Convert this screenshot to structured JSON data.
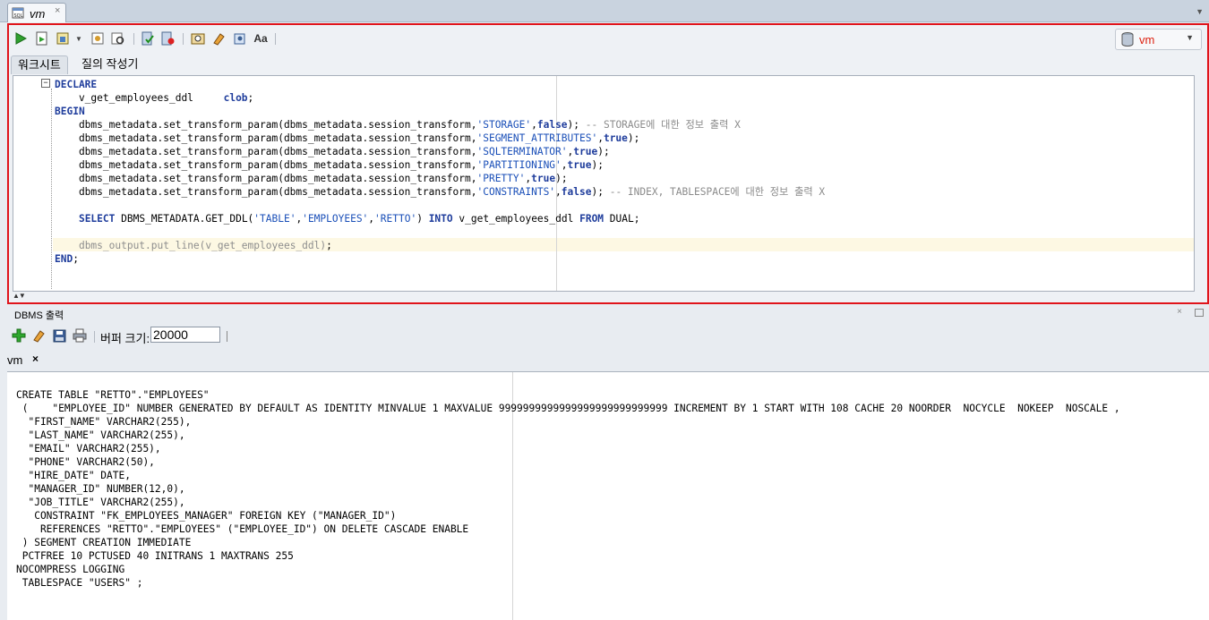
{
  "window_tab": {
    "label": "vm",
    "close": "×"
  },
  "toolbar": {
    "buttons": [
      "run-statement",
      "run-script",
      "autotrace",
      "dropdown",
      "explain-plan",
      "sql-tuning",
      "commit",
      "rollback",
      "sql-history",
      "clear",
      "format",
      "to-upper-lower"
    ],
    "connection": "vm"
  },
  "worksheet_tabs": [
    "워크시트",
    "질의 작성기"
  ],
  "editor": {
    "lines": [
      [
        [
          "kw",
          "DECLARE"
        ]
      ],
      [
        [
          "t",
          "    v_get_employees_ddl     "
        ],
        [
          "kw",
          "clob"
        ],
        [
          "t",
          ";"
        ]
      ],
      [
        [
          "kw",
          "BEGIN"
        ]
      ],
      [
        [
          "t",
          "    dbms_metadata.set_transform_param(dbms_metadata.session_transform,"
        ],
        [
          "str",
          "'STORAGE'"
        ],
        [
          "t",
          ","
        ],
        [
          "kw",
          "false"
        ],
        [
          "t",
          "); "
        ],
        [
          "cmt",
          "-- STORAGE에 대한 정보 출력 X"
        ]
      ],
      [
        [
          "t",
          "    dbms_metadata.set_transform_param(dbms_metadata.session_transform,"
        ],
        [
          "str",
          "'SEGMENT_ATTRIBUTES'"
        ],
        [
          "t",
          ","
        ],
        [
          "kw",
          "true"
        ],
        [
          "t",
          ");"
        ]
      ],
      [
        [
          "t",
          "    dbms_metadata.set_transform_param(dbms_metadata.session_transform,"
        ],
        [
          "str",
          "'SQLTERMINATOR'"
        ],
        [
          "t",
          ","
        ],
        [
          "kw",
          "true"
        ],
        [
          "t",
          ");"
        ]
      ],
      [
        [
          "t",
          "    dbms_metadata.set_transform_param(dbms_metadata.session_transform,"
        ],
        [
          "str",
          "'PARTITIONING'"
        ],
        [
          "t",
          ","
        ],
        [
          "kw",
          "true"
        ],
        [
          "t",
          ");"
        ]
      ],
      [
        [
          "t",
          "    dbms_metadata.set_transform_param(dbms_metadata.session_transform,"
        ],
        [
          "str",
          "'PRETTY'"
        ],
        [
          "t",
          ","
        ],
        [
          "kw",
          "true"
        ],
        [
          "t",
          ");"
        ]
      ],
      [
        [
          "t",
          "    dbms_metadata.set_transform_param(dbms_metadata.session_transform,"
        ],
        [
          "str",
          "'CONSTRAINTS'"
        ],
        [
          "t",
          ","
        ],
        [
          "kw",
          "false"
        ],
        [
          "t",
          "); "
        ],
        [
          "cmt",
          "-- INDEX, TABLESPACE에 대한 정보 출력 X"
        ]
      ],
      [
        [
          "t",
          ""
        ]
      ],
      [
        [
          "t",
          "    "
        ],
        [
          "kw",
          "SELECT"
        ],
        [
          "t",
          " DBMS_METADATA.GET_DDL("
        ],
        [
          "str",
          "'TABLE'"
        ],
        [
          "t",
          ","
        ],
        [
          "str",
          "'EMPLOYEES'"
        ],
        [
          "t",
          ","
        ],
        [
          "str",
          "'RETTO'"
        ],
        [
          "t",
          ") "
        ],
        [
          "kw",
          "INTO"
        ],
        [
          "t",
          " v_get_employees_ddl "
        ],
        [
          "kw",
          "FROM"
        ],
        [
          "t",
          " DUAL;"
        ]
      ],
      [
        [
          "t",
          ""
        ]
      ],
      [
        [
          "t",
          "    "
        ],
        [
          "dim",
          "dbms_output.put_line(v_get_employees_ddl)"
        ],
        [
          "t",
          ";"
        ]
      ],
      [
        [
          "kw",
          "END"
        ],
        [
          "t",
          ";"
        ]
      ]
    ]
  },
  "dbms_output": {
    "title": "DBMS 출력",
    "close": "×",
    "buffer_label": "버퍼 크기:",
    "buffer_value": "20000",
    "tab_label": "vm",
    "tab_close": "×",
    "text": "CREATE TABLE \"RETTO\".\"EMPLOYEES\"\n (    \"EMPLOYEE_ID\" NUMBER GENERATED BY DEFAULT AS IDENTITY MINVALUE 1 MAXVALUE 9999999999999999999999999999 INCREMENT BY 1 START WITH 108 CACHE 20 NOORDER  NOCYCLE  NOKEEP  NOSCALE ,\n  \"FIRST_NAME\" VARCHAR2(255),\n  \"LAST_NAME\" VARCHAR2(255),\n  \"EMAIL\" VARCHAR2(255),\n  \"PHONE\" VARCHAR2(50),\n  \"HIRE_DATE\" DATE,\n  \"MANAGER_ID\" NUMBER(12,0),\n  \"JOB_TITLE\" VARCHAR2(255),\n   CONSTRAINT \"FK_EMPLOYEES_MANAGER\" FOREIGN KEY (\"MANAGER_ID\")\n    REFERENCES \"RETTO\".\"EMPLOYEES\" (\"EMPLOYEE_ID\") ON DELETE CASCADE ENABLE\n ) SEGMENT CREATION IMMEDIATE\n PCTFREE 10 PCTUSED 40 INITRANS 1 MAXTRANS 255\nNOCOMPRESS LOGGING\n TABLESPACE \"USERS\" ;"
  }
}
